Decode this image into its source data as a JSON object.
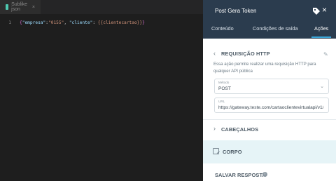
{
  "editor": {
    "tab": {
      "name": "Sublike json",
      "close": "×"
    },
    "lines": [
      {
        "number": "1",
        "open_brace": "{",
        "key1": "\"empresa\"",
        "colon1": ":",
        "val1": "\"0155\"",
        "comma": ", ",
        "key2": "\"cliente\"",
        "colon2": ": ",
        "val2": "{{clientecartao}}",
        "close_brace": "}"
      }
    ]
  },
  "panel": {
    "title": "Post Gera Token",
    "tag_icon": "tag-icon",
    "close_icon": "×",
    "tabs": [
      {
        "label": "Conteúdo",
        "active": false
      },
      {
        "label": "Condições de saída",
        "active": false
      },
      {
        "label": "Ações",
        "active": true
      }
    ],
    "section_http": {
      "title": "REQUISIÇÃO HTTP",
      "chevron": "‹",
      "edit_icon": "✎",
      "description": "Essa ação permite realizar uma requisição HTTP para qualquer API pública"
    },
    "method_field": {
      "label": "Método",
      "value": "POST",
      "caret": "⌄"
    },
    "url_field": {
      "label": "URL",
      "value": "https://gateway.teste.com/cartaoclientevirtualapi/v1/t"
    },
    "headers": {
      "title": "CABEÇALHOS",
      "chevron": "›"
    },
    "body": {
      "title": "CORPO"
    },
    "save_response": {
      "title": "SALVAR RESPOSTA",
      "info": "i"
    }
  },
  "colors": {
    "panel_header": "#2b3c4e",
    "accent": "#3aa7d9",
    "editor_bg": "#1e1e1e",
    "corpo_band": "#e6f4f7"
  }
}
